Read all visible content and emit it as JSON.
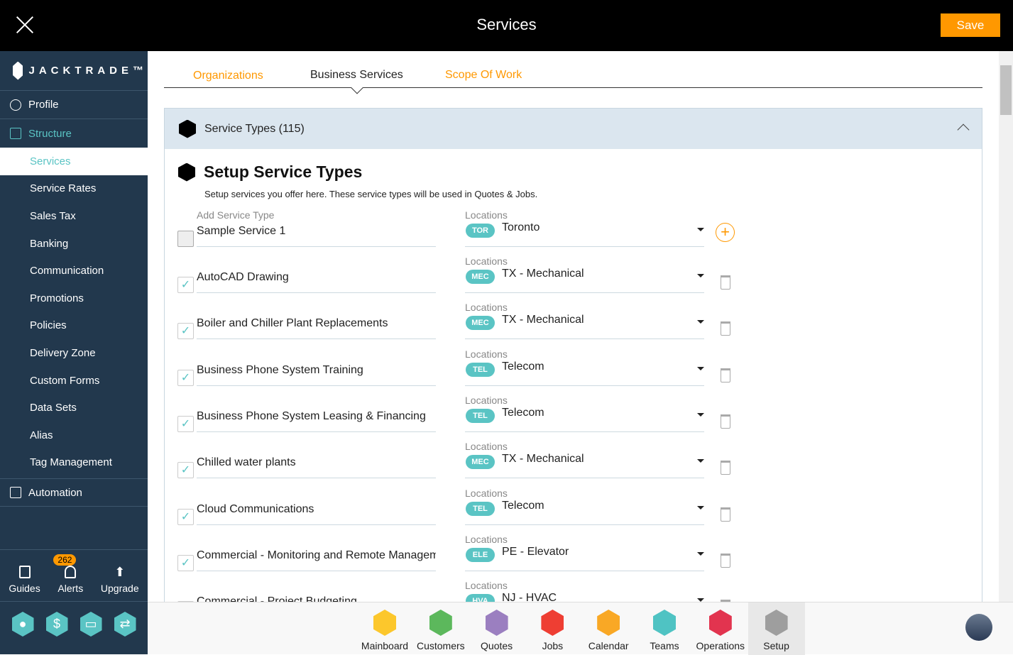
{
  "header": {
    "title": "Services",
    "save_label": "Save"
  },
  "sidebar": {
    "brand": "JACKTRADE™",
    "profile": "Profile",
    "structure": "Structure",
    "items": [
      "Services",
      "Service Rates",
      "Sales Tax",
      "Banking",
      "Communication",
      "Promotions",
      "Policies",
      "Delivery Zone",
      "Custom Forms",
      "Data Sets",
      "Alias",
      "Tag Management"
    ],
    "automation": "Automation",
    "guides": "Guides",
    "alerts": "Alerts",
    "alerts_count": "262",
    "upgrade": "Upgrade"
  },
  "tabs": [
    "Organizations",
    "Business Services",
    "Scope Of Work"
  ],
  "panel": {
    "header": "Service Types (115)",
    "title": "Setup Service Types",
    "description": "Setup services you offer here. These service types will be used in Quotes & Jobs.",
    "add_label": "Add Service Type",
    "locations_label": "Locations",
    "new_row": {
      "name": "Sample Service 1",
      "code": "TOR",
      "location": "Toronto"
    },
    "rows": [
      {
        "name": "AutoCAD Drawing",
        "code": "MEC",
        "location": "TX - Mechanical"
      },
      {
        "name": "Boiler and Chiller Plant Replacements",
        "code": "MEC",
        "location": "TX - Mechanical"
      },
      {
        "name": "Business  Phone System Training",
        "code": "TEL",
        "location": "Telecom"
      },
      {
        "name": "Business Phone System Leasing & Financing",
        "code": "TEL",
        "location": "Telecom"
      },
      {
        "name": "Chilled water plants",
        "code": "MEC",
        "location": "TX - Mechanical"
      },
      {
        "name": "Cloud Communications",
        "code": "TEL",
        "location": "Telecom"
      },
      {
        "name": "Commercial  - Monitoring and Remote Management",
        "code": "ELE",
        "location": "PE - Elevator"
      },
      {
        "name": "Commercial  - Project Budgeting",
        "code": "HVA",
        "location": "NJ - HVAC"
      }
    ]
  },
  "apps": [
    {
      "label": "Mainboard",
      "color": "#fcc72c"
    },
    {
      "label": "Customers",
      "color": "#5cb85c"
    },
    {
      "label": "Quotes",
      "color": "#9b7fc0"
    },
    {
      "label": "Jobs",
      "color": "#ee3e33"
    },
    {
      "label": "Calendar",
      "color": "#f9a825"
    },
    {
      "label": "Teams",
      "color": "#4fc3c3"
    },
    {
      "label": "Operations",
      "color": "#e2344f"
    },
    {
      "label": "Setup",
      "color": "#9e9e9e"
    }
  ]
}
